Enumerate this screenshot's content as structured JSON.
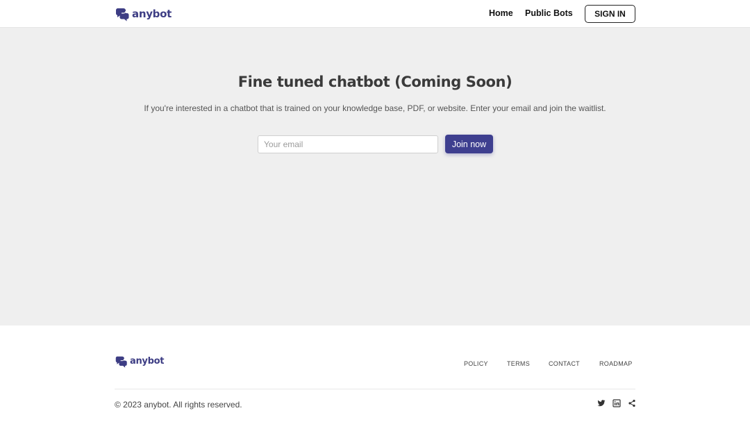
{
  "header": {
    "logo_text": "anybot",
    "nav": {
      "home": "Home",
      "public_bots": "Public Bots"
    },
    "signin_label": "SIGN IN"
  },
  "main": {
    "title": "Fine tuned chatbot (Coming Soon)",
    "subtitle": "If you're interested in a chatbot that is trained on your knowledge base, PDF, or website. Enter your email and join the waitlist.",
    "email": {
      "value": "",
      "placeholder": "Your email"
    },
    "join_label": "Join now"
  },
  "footer": {
    "logo_text": "anybot",
    "links": {
      "policy": "POLICY",
      "terms": "TERMS",
      "contact": "CONTACT",
      "roadmap": "ROADMAP"
    },
    "copyright": "© 2023 anybot. All rights reserved.",
    "social_icons": [
      "twitter-icon",
      "linkedin-icon",
      "share-icon"
    ]
  },
  "colors": {
    "brand": "#3d3d84",
    "button": "#3e3f8f",
    "main_bg": "#efefef"
  }
}
